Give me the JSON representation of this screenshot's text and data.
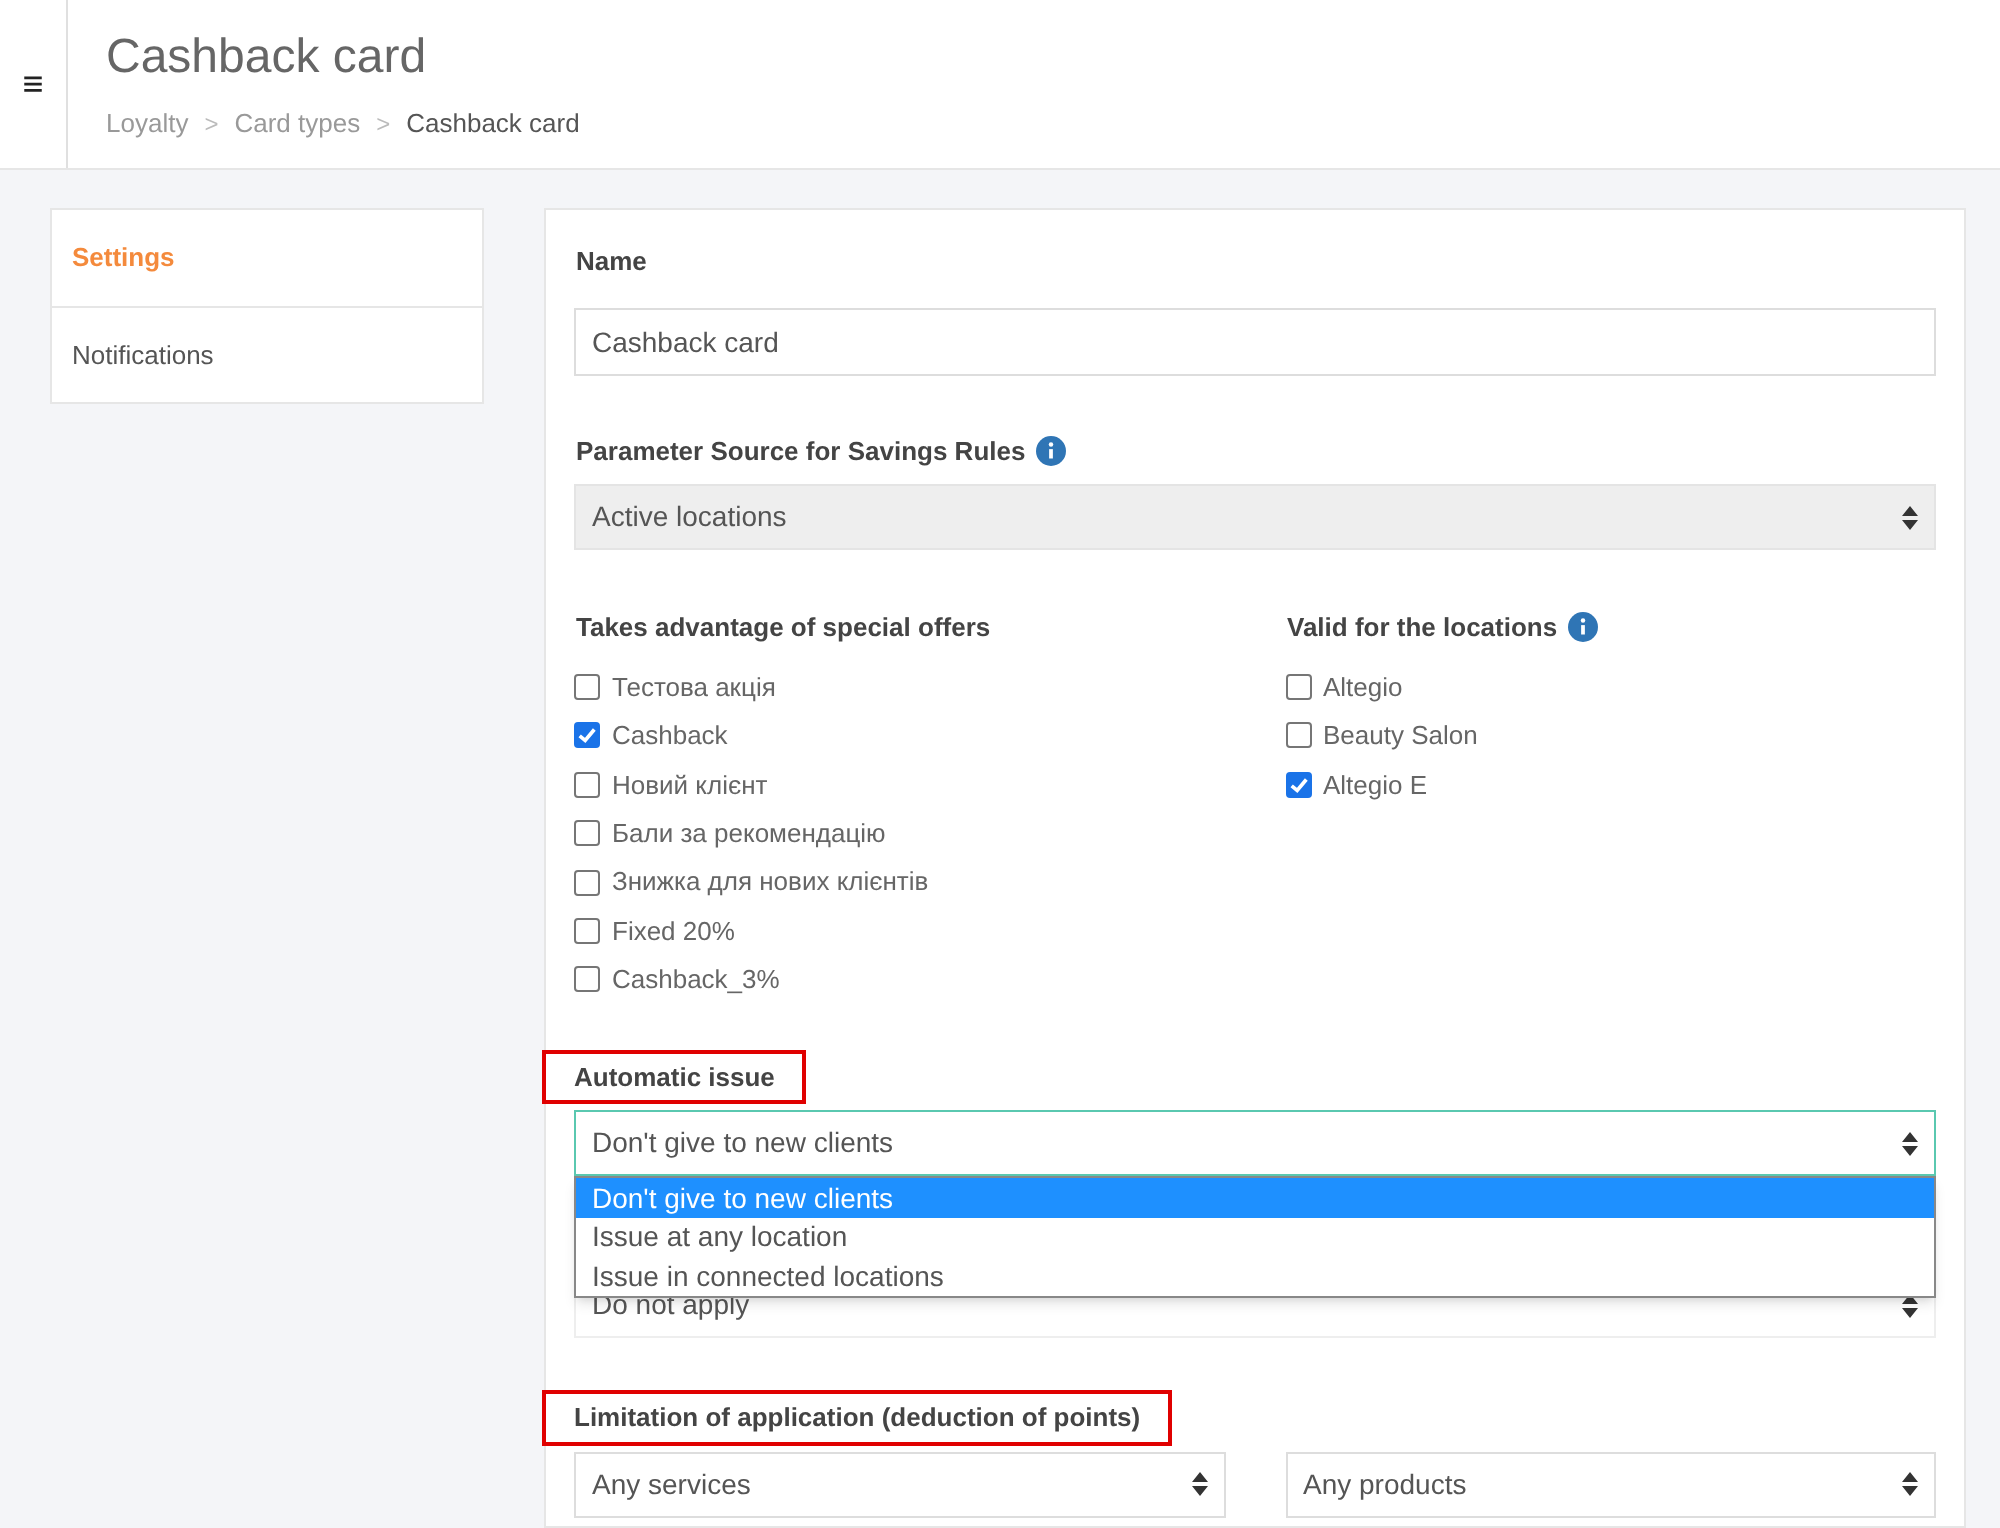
{
  "header": {
    "menu_icon": "≡",
    "title": "Cashback card",
    "breadcrumbs": [
      {
        "label": "Loyalty",
        "current": false
      },
      {
        "label": "Card types",
        "current": false
      },
      {
        "label": "Cashback card",
        "current": true
      }
    ],
    "separator": ">"
  },
  "sidebar": {
    "items": [
      {
        "label": "Settings",
        "selected": true
      },
      {
        "label": "Notifications",
        "selected": false
      }
    ]
  },
  "form": {
    "name": {
      "label": "Name",
      "value": "Cashback card"
    },
    "parameter_source": {
      "label": "Parameter Source for Savings Rules",
      "info": true,
      "value": "Active locations",
      "disabled": true
    },
    "special_offers": {
      "label": "Takes advantage of special offers",
      "options": [
        {
          "label": "Тестова акція",
          "checked": false
        },
        {
          "label": "Cashback",
          "checked": true
        },
        {
          "label": "Новий клієнт",
          "checked": false
        },
        {
          "label": "Бали за рекомендацію",
          "checked": false
        },
        {
          "label": "Знижка для нових клієнтів",
          "checked": false
        },
        {
          "label": "Fixed 20%",
          "checked": false
        },
        {
          "label": "Cashback_3%",
          "checked": false
        }
      ]
    },
    "locations": {
      "label": "Valid for the locations",
      "info": true,
      "options": [
        {
          "label": "Altegio",
          "checked": false
        },
        {
          "label": "Beauty Salon",
          "checked": false
        },
        {
          "label": "Altegio E",
          "checked": true
        }
      ]
    },
    "automatic_issue": {
      "label": "Automatic issue",
      "highlighted": true,
      "value": "Don't give to new clients",
      "open": true,
      "options": [
        {
          "label": "Don't give to new clients",
          "selected": true
        },
        {
          "label": "Issue at any location",
          "selected": false
        },
        {
          "label": "Issue in connected locations",
          "selected": false
        }
      ]
    },
    "hidden_select": {
      "value": "Do not apply"
    },
    "limitation": {
      "label": "Limitation of application (deduction of points)",
      "highlighted": true,
      "selects": [
        {
          "value": "Any services"
        },
        {
          "value": "Any products"
        }
      ]
    }
  }
}
